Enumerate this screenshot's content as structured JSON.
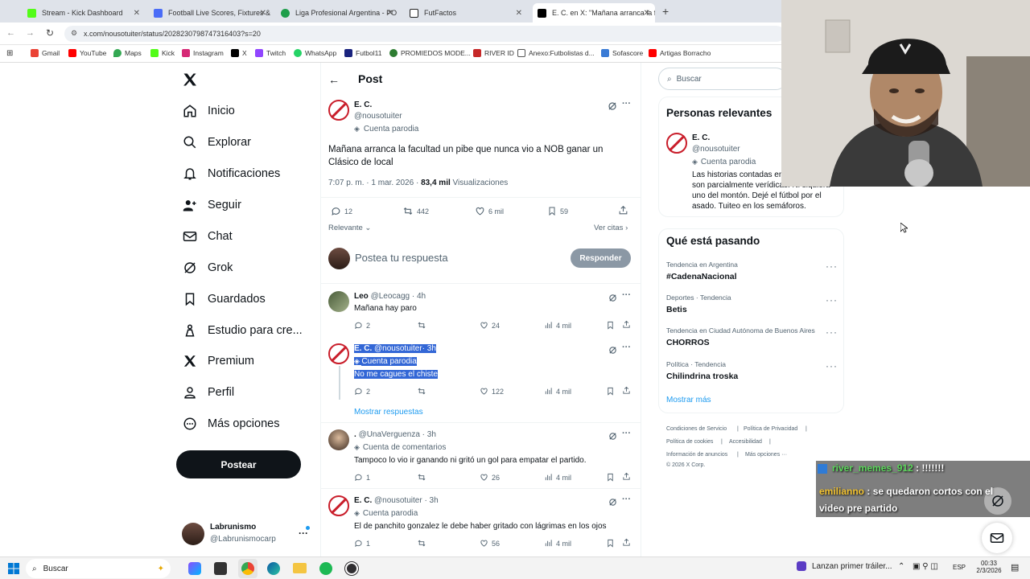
{
  "browser": {
    "tabs": [
      {
        "label": "Stream - Kick Dashboard",
        "color": "#53fc18"
      },
      {
        "label": "Football Live Scores, Fixtures &",
        "color": "#4a6cf7"
      },
      {
        "label": "Liga Profesional Argentina - PO",
        "color": "#1e9e4a"
      },
      {
        "label": "FutFactos",
        "color": "#222222"
      },
      {
        "label": "E. C. en X: \"Mañana arranca la fa",
        "color": "#000000"
      }
    ],
    "url": "x.com/nousotuiter/status/2028230798747316403?s=20",
    "bookmarks": [
      "Gmail",
      "YouTube",
      "Maps",
      "Kick",
      "Instagram",
      "X",
      "Twitch",
      "WhatsApp",
      "Futbol11",
      "PROMIEDOS MODE...",
      "RIVER ID",
      "Anexo:Futbolistas d...",
      "Sofascore",
      "Artigas Borracho"
    ]
  },
  "nav": {
    "items": [
      "Inicio",
      "Explorar",
      "Notificaciones",
      "Seguir",
      "Chat",
      "Grok",
      "Guardados",
      "Estudio para cre...",
      "Premium",
      "Perfil",
      "Más opciones"
    ],
    "post_button": "Postear",
    "account_name": "Labrunismo",
    "account_handle": "@Labrunismocarp"
  },
  "post": {
    "header": "Post",
    "author_name": "E. C.",
    "author_handle": "@nousotuiter",
    "parody_label": "Cuenta parodia",
    "text": "Mañana arranca la facultad un pibe que nunca vio a NOB ganar un Clásico de local",
    "time": "7:07 p. m. · 1 mar. 2026 ·",
    "views_count": "83,4 mil",
    "views_label": "Visualizaciones",
    "replies": "12",
    "reposts": "442",
    "likes": "6 mil",
    "bookmarks": "59",
    "sort_label": "Relevante",
    "quotes_label": "Ver citas",
    "reply_placeholder": "Postea tu respuesta",
    "reply_button": "Responder"
  },
  "replies": [
    {
      "name": "Leo",
      "handle": "@Leocagg",
      "time": "· 4h",
      "text": "Mañana hay paro",
      "replies": "2",
      "likes": "24",
      "views": "4 mil"
    },
    {
      "name": "E. C.",
      "handle": "@nousotuiter",
      "time": "· 3h",
      "badge": "Cuenta parodia",
      "text": "No me cagues el chiste",
      "replies": "2",
      "likes": "122",
      "views": "4 mil",
      "show_replies": "Mostrar respuestas"
    },
    {
      "name": ".",
      "handle": "@UnaVerguenza",
      "time": "· 3h",
      "badge": "Cuenta de comentarios",
      "text": "Tampoco lo vio ir ganando ni gritó un gol para empatar el partido.",
      "replies": "1",
      "likes": "26",
      "views": "4 mil"
    },
    {
      "name": "E. C.",
      "handle": "@nousotuiter",
      "time": "· 3h",
      "badge": "Cuenta parodia",
      "text": "El de panchito gonzalez le debe haber gritado con lágrimas en los ojos",
      "replies": "1",
      "likes": "56",
      "views": "4 mil"
    }
  ],
  "sidebar": {
    "search_placeholder": "Buscar",
    "relevant_title": "Personas relevantes",
    "relevant_name": "E. C.",
    "relevant_handle": "@nousotuiter",
    "relevant_badge": "Cuenta parodia",
    "relevant_bio": "Las historias contadas en esta cuenta son parcialmente verídicas. Ni siquiera uno del montón. Dejé el fútbol por el asado. Tuiteo en los semáforos.",
    "trends_title": "Qué está pasando",
    "trends": [
      {
        "context": "Tendencia en Argentina",
        "name": "#CadenaNacional"
      },
      {
        "context": "Deportes · Tendencia",
        "name": "Betis"
      },
      {
        "context": "Tendencia en Ciudad Autónoma de Buenos Aires",
        "name": "CHORROS"
      },
      {
        "context": "Política · Tendencia",
        "name": "Chilindrina troska"
      }
    ],
    "show_more": "Mostrar más",
    "footer": [
      "Condiciones de Servicio",
      "Política de Privacidad",
      "Política de cookies",
      "Accesibilidad",
      "Información de anuncios",
      "Más opciones ···",
      "© 2026 X Corp."
    ]
  },
  "chat": [
    {
      "user": "river_memes_912",
      "user_color": "#5cd65c",
      "msg": ": !!!!!!!"
    },
    {
      "user": "emilianno",
      "user_color": "#f2c230",
      "msg": ": se quedaron cortos con el video pre partido"
    }
  ],
  "taskbar": {
    "search": "Buscar",
    "news": "Lanzan primer tráiler...",
    "lang": "ESP",
    "time": "00:33",
    "date": "2/3/2026"
  },
  "colors": {
    "accent": "#1d9bf0",
    "brand_red": "#c91d2a",
    "selection": "#3367d6"
  }
}
